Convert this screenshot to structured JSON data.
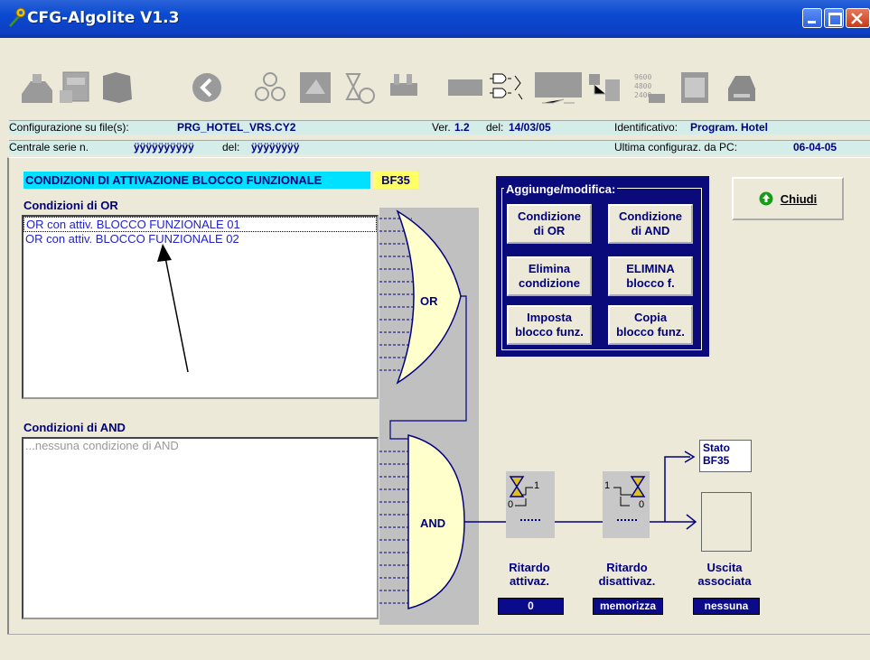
{
  "window": {
    "title": "CFG-Algolite V1.3"
  },
  "info": {
    "config_label": "Configurazione su file(s):",
    "config_file": "PRG_HOTEL_VRS.CY2",
    "ver_label": "Ver.",
    "ver_value": "1.2",
    "date_label": "del:",
    "date_value": "14/03/05",
    "id_label": "Identificativo:",
    "id_value": "Program. Hotel",
    "serial_label": "Centrale serie n.",
    "serial_value": "ÿÿÿÿÿÿÿÿÿÿ",
    "serial_date_label": "del:",
    "serial_date_value": "ÿÿÿÿÿÿÿÿ",
    "last_config_label": "Ultima configuraz. da PC:",
    "last_config_value": "06-04-05"
  },
  "panel": {
    "header": "CONDIZIONI DI ATTIVAZIONE BLOCCO FUNZIONALE",
    "code": "BF35",
    "or_label": "Condizioni di OR",
    "or_items": [
      "OR  con attiv. BLOCCO FUNZIONALE 01",
      "OR  con attiv. BLOCCO FUNZIONALE 02"
    ],
    "and_label": "Condizioni di AND",
    "and_placeholder": "...nessuna condizione di AND",
    "gate_or": "OR",
    "gate_and": "AND"
  },
  "commands": {
    "group_title": "Aggiunge/modifica:",
    "cond_or": "Condizione\ndi OR",
    "cond_and": "Condizione\ndi AND",
    "elimina_cond": "Elimina\ncondizione",
    "elimina_blocco": "ELIMINA\nblocco f.",
    "imposta": "Imposta\nblocco funz.",
    "copia": "Copia\nblocco funz.",
    "chiudi": "Chiudi"
  },
  "outputs": {
    "stato_label": "Stato\nBF35",
    "rit_attiv_label": "Ritardo\nattivaz.",
    "rit_attiv_value": "0",
    "rit_disatt_label": "Ritardo\ndisattivaz.",
    "rit_disatt_value": "memorizza",
    "uscita_label": "Uscita\nassociata",
    "uscita_value": "nessuna",
    "timer1_on": "1",
    "timer1_off": "0",
    "timer2_on": "1",
    "timer2_off": "0"
  },
  "colors": {
    "accent": "#000080",
    "header_bg": "#00e0ff",
    "code_bg": "#ffff66",
    "group_bg": "#0a0a7a",
    "info_bg": "#d4ede9"
  }
}
